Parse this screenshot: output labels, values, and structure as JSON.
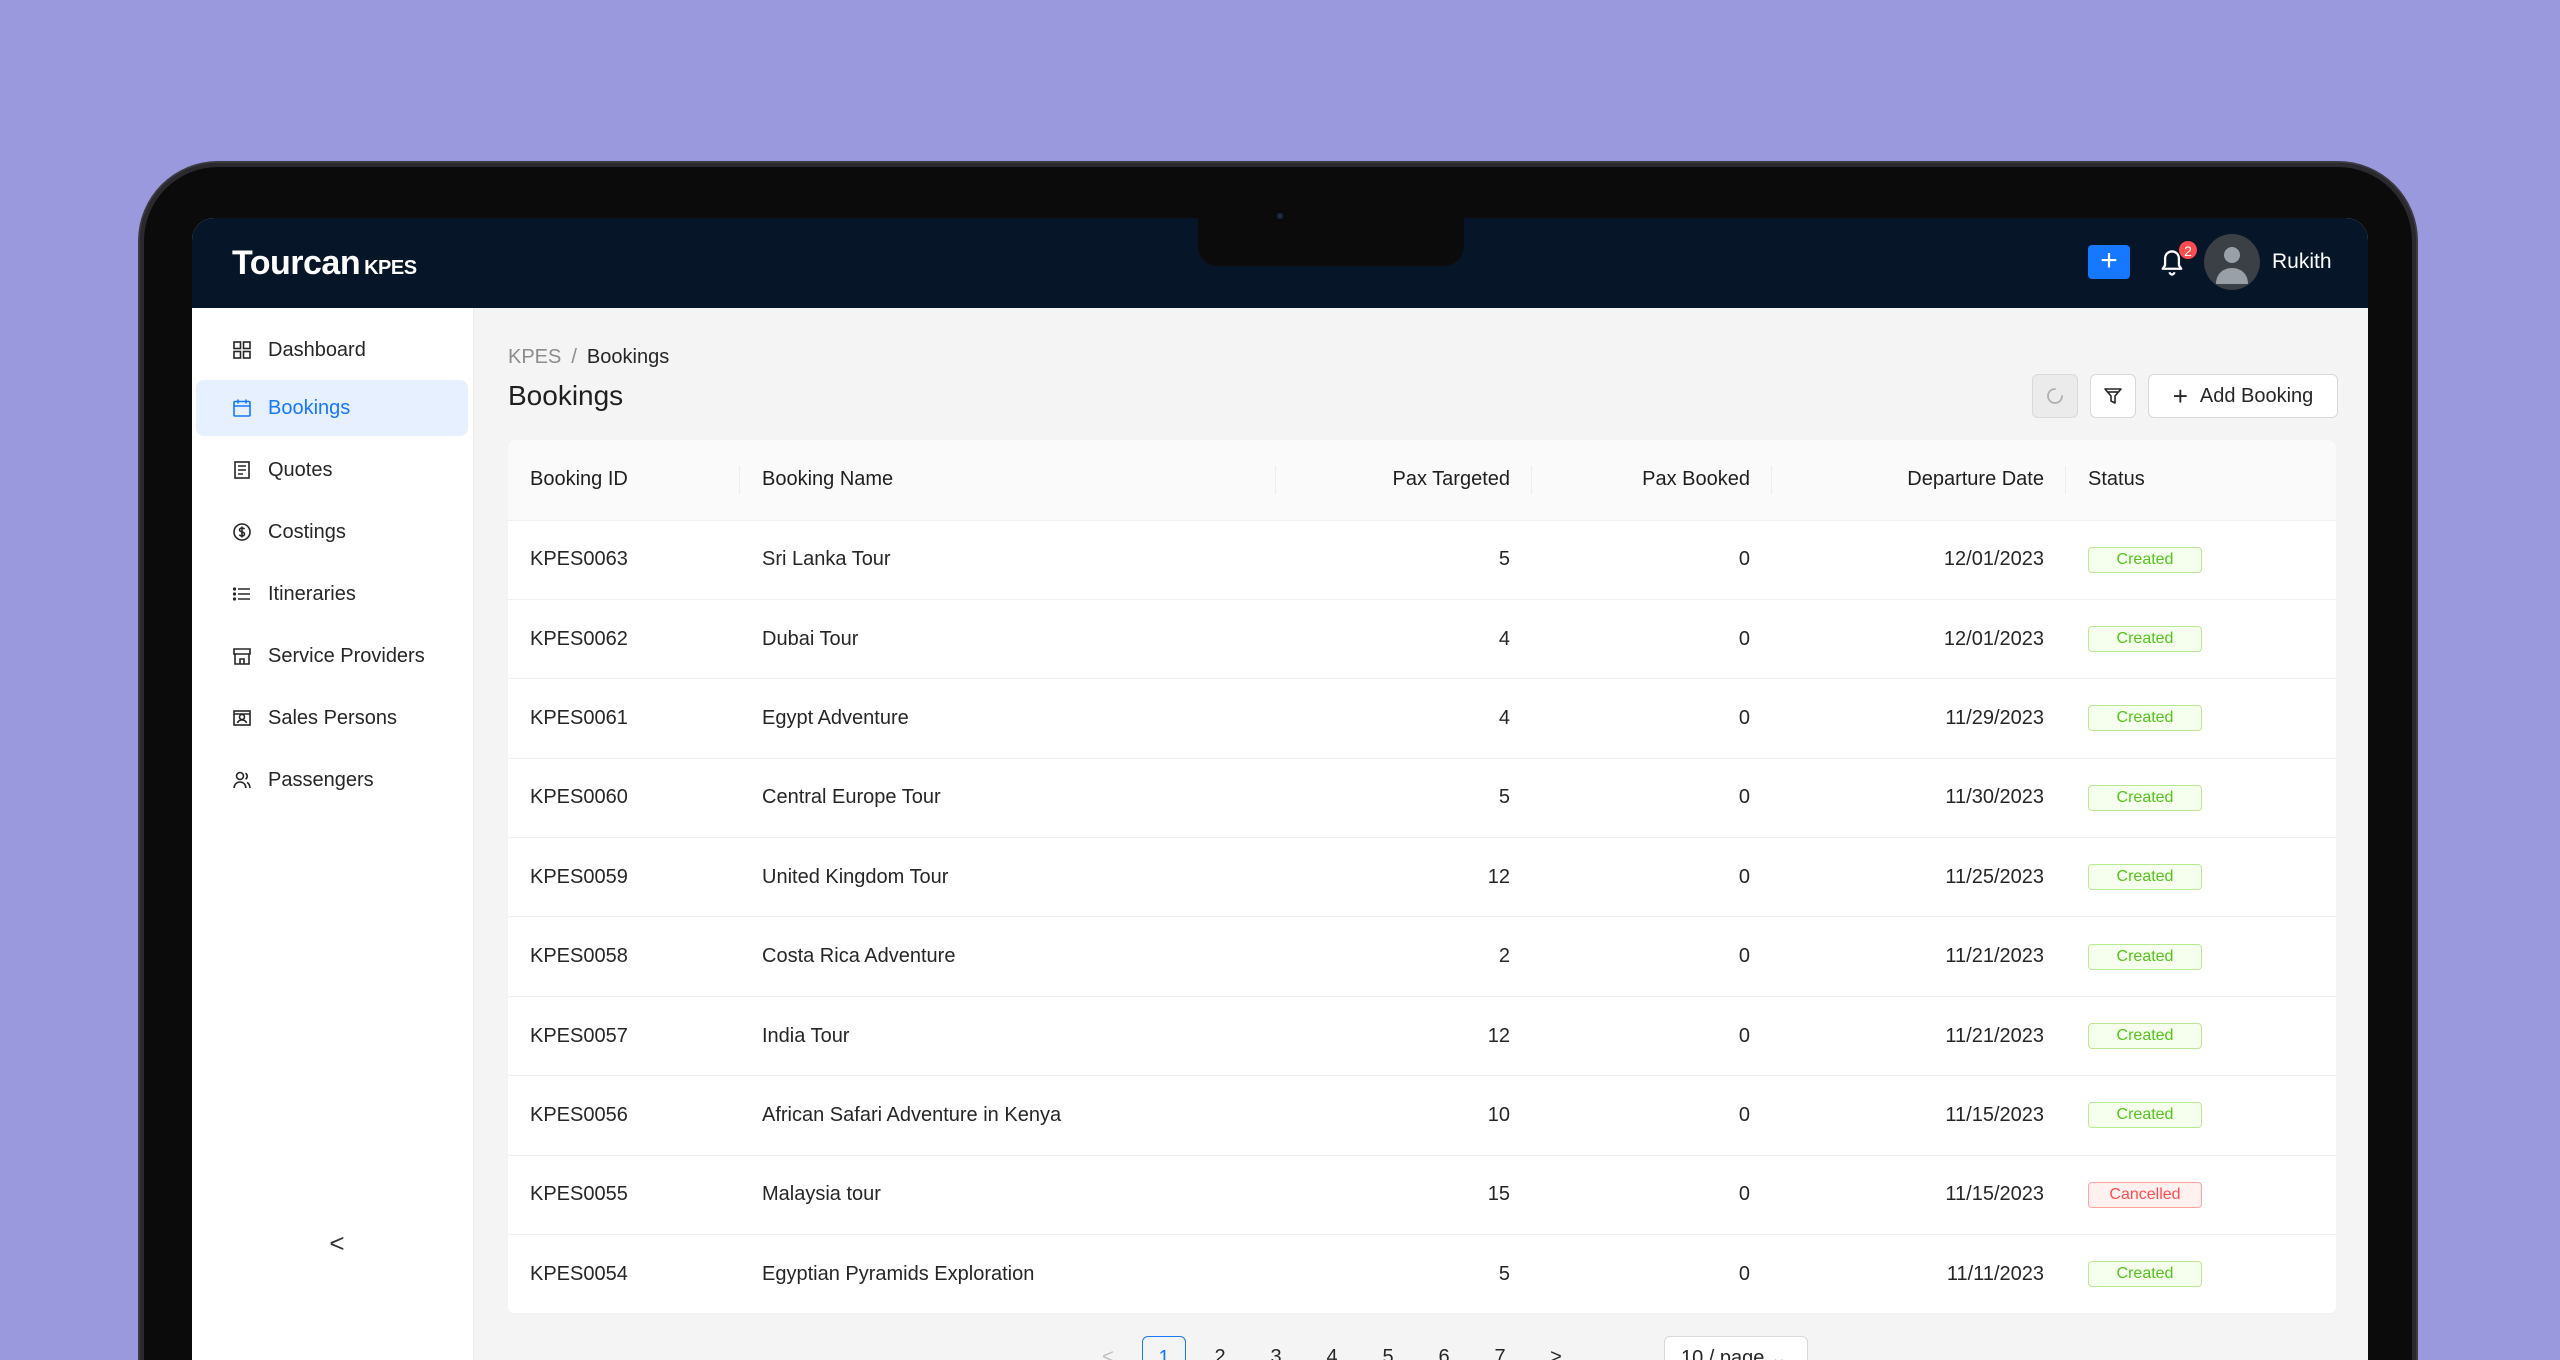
{
  "app": {
    "name": "Tourcan",
    "suffix": "KPES"
  },
  "header": {
    "add_label": "+",
    "notification_count": "2",
    "user_name": "Rukith"
  },
  "sidebar": {
    "items": [
      {
        "label": "Dashboard",
        "icon": "dashboard-icon"
      },
      {
        "label": "Bookings",
        "icon": "calendar-icon",
        "active": true
      },
      {
        "label": "Quotes",
        "icon": "document-icon"
      },
      {
        "label": "Costings",
        "icon": "dollar-circle-icon"
      },
      {
        "label": "Itineraries",
        "icon": "list-icon"
      },
      {
        "label": "Service Providers",
        "icon": "shop-icon"
      },
      {
        "label": "Sales Persons",
        "icon": "id-card-icon"
      },
      {
        "label": "Passengers",
        "icon": "users-icon"
      }
    ],
    "collapse_label": "<"
  },
  "breadcrumb": {
    "root": "KPES",
    "separator": "/",
    "current": "Bookings"
  },
  "page": {
    "title": "Bookings",
    "add_button": "Add Booking"
  },
  "table": {
    "columns": [
      "Booking ID",
      "Booking Name",
      "Pax Targeted",
      "Pax Booked",
      "Departure Date",
      "Status"
    ],
    "rows": [
      {
        "id": "KPES0063",
        "name": "Sri Lanka Tour",
        "pax_targeted": "5",
        "pax_booked": "0",
        "date": "12/01/2023",
        "status": "Created"
      },
      {
        "id": "KPES0062",
        "name": "Dubai Tour",
        "pax_targeted": "4",
        "pax_booked": "0",
        "date": "12/01/2023",
        "status": "Created"
      },
      {
        "id": "KPES0061",
        "name": "Egypt Adventure",
        "pax_targeted": "4",
        "pax_booked": "0",
        "date": "11/29/2023",
        "status": "Created"
      },
      {
        "id": "KPES0060",
        "name": "Central Europe Tour",
        "pax_targeted": "5",
        "pax_booked": "0",
        "date": "11/30/2023",
        "status": "Created"
      },
      {
        "id": "KPES0059",
        "name": "United Kingdom Tour",
        "pax_targeted": "12",
        "pax_booked": "0",
        "date": "11/25/2023",
        "status": "Created"
      },
      {
        "id": "KPES0058",
        "name": "Costa Rica Adventure",
        "pax_targeted": "2",
        "pax_booked": "0",
        "date": "11/21/2023",
        "status": "Created"
      },
      {
        "id": "KPES0057",
        "name": "India Tour",
        "pax_targeted": "12",
        "pax_booked": "0",
        "date": "11/21/2023",
        "status": "Created"
      },
      {
        "id": "KPES0056",
        "name": "African Safari Adventure in Kenya",
        "pax_targeted": "10",
        "pax_booked": "0",
        "date": "11/15/2023",
        "status": "Created"
      },
      {
        "id": "KPES0055",
        "name": "Malaysia tour",
        "pax_targeted": "15",
        "pax_booked": "0",
        "date": "11/15/2023",
        "status": "Cancelled"
      },
      {
        "id": "KPES0054",
        "name": "Egyptian Pyramids Exploration",
        "pax_targeted": "5",
        "pax_booked": "0",
        "date": "11/11/2023",
        "status": "Created"
      }
    ]
  },
  "pagination": {
    "prev": "<",
    "pages": [
      "1",
      "2",
      "3",
      "4",
      "5",
      "6",
      "7"
    ],
    "current": "1",
    "next": ">",
    "page_size": "10 / page"
  },
  "colors": {
    "background": "#9b99de",
    "topbar": "#061528",
    "primary": "#1677ff",
    "created": "#52c41a",
    "cancelled": "#ff4d4f"
  }
}
